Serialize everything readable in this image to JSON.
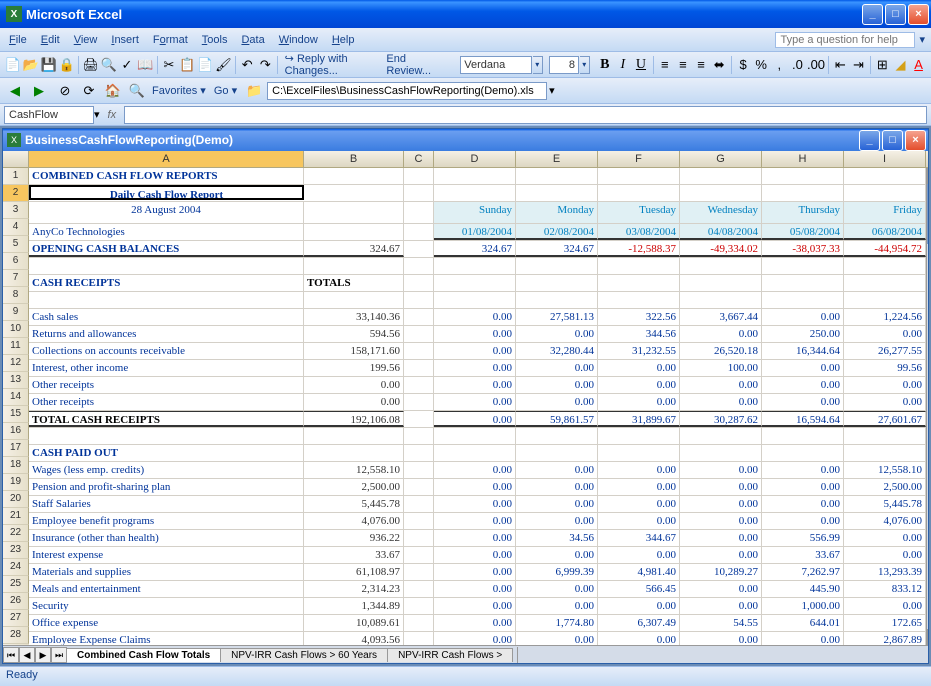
{
  "app": {
    "title": "Microsoft Excel"
  },
  "menu": {
    "file": "File",
    "edit": "Edit",
    "view": "View",
    "insert": "Insert",
    "format": "Format",
    "tools": "Tools",
    "data": "Data",
    "window": "Window",
    "help": "Help",
    "question_placeholder": "Type a question for help"
  },
  "toolbar": {
    "font_name": "Verdana",
    "font_size": "8",
    "reply": "Reply with Changes...",
    "end_review": "End Review..."
  },
  "navbar": {
    "favorites": "Favorites",
    "go": "Go",
    "path": "C:\\ExcelFiles\\BusinessCashFlowReporting(Demo).xls"
  },
  "formula": {
    "name_box": "CashFlow"
  },
  "doc": {
    "title": "BusinessCashFlowReporting(Demo)"
  },
  "cols": [
    "A",
    "B",
    "C",
    "D",
    "E",
    "F",
    "G",
    "H",
    "I"
  ],
  "report": {
    "title1": "COMBINED CASH FLOW REPORTS",
    "title2": "Daily Cash Flow Report",
    "date": "28 August 2004",
    "company": "AnyCo Technologies",
    "opening_label": "OPENING CASH BALANCES",
    "opening_total": "324.67",
    "days": [
      "Sunday",
      "Monday",
      "Tuesday",
      "Wednesday",
      "Thursday",
      "Friday"
    ],
    "dates": [
      "01/08/2004",
      "02/08/2004",
      "03/08/2004",
      "04/08/2004",
      "05/08/2004",
      "06/08/2004"
    ],
    "opening_vals": [
      "324.67",
      "324.67",
      "-12,588.37",
      "-49,334.02",
      "-38,037.33",
      "-44,954.72"
    ],
    "receipts_header": "CASH RECEIPTS",
    "totals_label": "TOTALS",
    "receipts": [
      {
        "label": "Cash sales",
        "total": "33,140.36",
        "v": [
          "0.00",
          "27,581.13",
          "322.56",
          "3,667.44",
          "0.00",
          "1,224.56"
        ]
      },
      {
        "label": "Returns and allowances",
        "total": "594.56",
        "v": [
          "0.00",
          "0.00",
          "344.56",
          "0.00",
          "250.00",
          "0.00"
        ]
      },
      {
        "label": "Collections on accounts receivable",
        "total": "158,171.60",
        "v": [
          "0.00",
          "32,280.44",
          "31,232.55",
          "26,520.18",
          "16,344.64",
          "26,277.55"
        ]
      },
      {
        "label": "Interest, other income",
        "total": "199.56",
        "v": [
          "0.00",
          "0.00",
          "0.00",
          "100.00",
          "0.00",
          "99.56"
        ]
      },
      {
        "label": "Other receipts",
        "total": "0.00",
        "v": [
          "0.00",
          "0.00",
          "0.00",
          "0.00",
          "0.00",
          "0.00"
        ]
      },
      {
        "label": "Other receipts",
        "total": "0.00",
        "v": [
          "0.00",
          "0.00",
          "0.00",
          "0.00",
          "0.00",
          "0.00"
        ]
      }
    ],
    "receipts_total_label": "TOTAL CASH RECEIPTS",
    "receipts_total": "192,106.08",
    "receipts_total_vals": [
      "0.00",
      "59,861.57",
      "31,899.67",
      "30,287.62",
      "16,594.64",
      "27,601.67"
    ],
    "paid_header": "CASH PAID OUT",
    "paid": [
      {
        "label": "Wages (less emp. credits)",
        "total": "12,558.10",
        "v": [
          "0.00",
          "0.00",
          "0.00",
          "0.00",
          "0.00",
          "12,558.10"
        ]
      },
      {
        "label": "Pension and profit-sharing plan",
        "total": "2,500.00",
        "v": [
          "0.00",
          "0.00",
          "0.00",
          "0.00",
          "0.00",
          "2,500.00"
        ]
      },
      {
        "label": "Staff Salaries",
        "total": "5,445.78",
        "v": [
          "0.00",
          "0.00",
          "0.00",
          "0.00",
          "0.00",
          "5,445.78"
        ]
      },
      {
        "label": "Employee benefit programs",
        "total": "4,076.00",
        "v": [
          "0.00",
          "0.00",
          "0.00",
          "0.00",
          "0.00",
          "4,076.00"
        ]
      },
      {
        "label": "Insurance (other than health)",
        "total": "936.22",
        "v": [
          "0.00",
          "34.56",
          "344.67",
          "0.00",
          "556.99",
          "0.00"
        ]
      },
      {
        "label": "Interest expense",
        "total": "33.67",
        "v": [
          "0.00",
          "0.00",
          "0.00",
          "0.00",
          "33.67",
          "0.00"
        ]
      },
      {
        "label": "Materials and supplies",
        "total": "61,108.97",
        "v": [
          "0.00",
          "6,999.39",
          "4,981.40",
          "10,289.27",
          "7,262.97",
          "13,293.39"
        ]
      },
      {
        "label": "Meals and entertainment",
        "total": "2,314.23",
        "v": [
          "0.00",
          "0.00",
          "566.45",
          "0.00",
          "445.90",
          "833.12"
        ]
      },
      {
        "label": "Security",
        "total": "1,344.89",
        "v": [
          "0.00",
          "0.00",
          "0.00",
          "0.00",
          "1,000.00",
          "0.00"
        ]
      },
      {
        "label": "Office expense",
        "total": "10,089.61",
        "v": [
          "0.00",
          "1,774.80",
          "6,307.49",
          "54.55",
          "644.01",
          "172.65"
        ]
      },
      {
        "label": "Employee Expense Claims",
        "total": "4,093.56",
        "v": [
          "0.00",
          "0.00",
          "0.00",
          "0.00",
          "0.00",
          "2,867.89"
        ]
      }
    ]
  },
  "tabs": {
    "tab1": "Combined Cash Flow Totals",
    "tab2": "NPV-IRR Cash Flows > 60 Years",
    "tab3": "NPV-IRR Cash Flows >"
  },
  "status": {
    "ready": "Ready"
  }
}
